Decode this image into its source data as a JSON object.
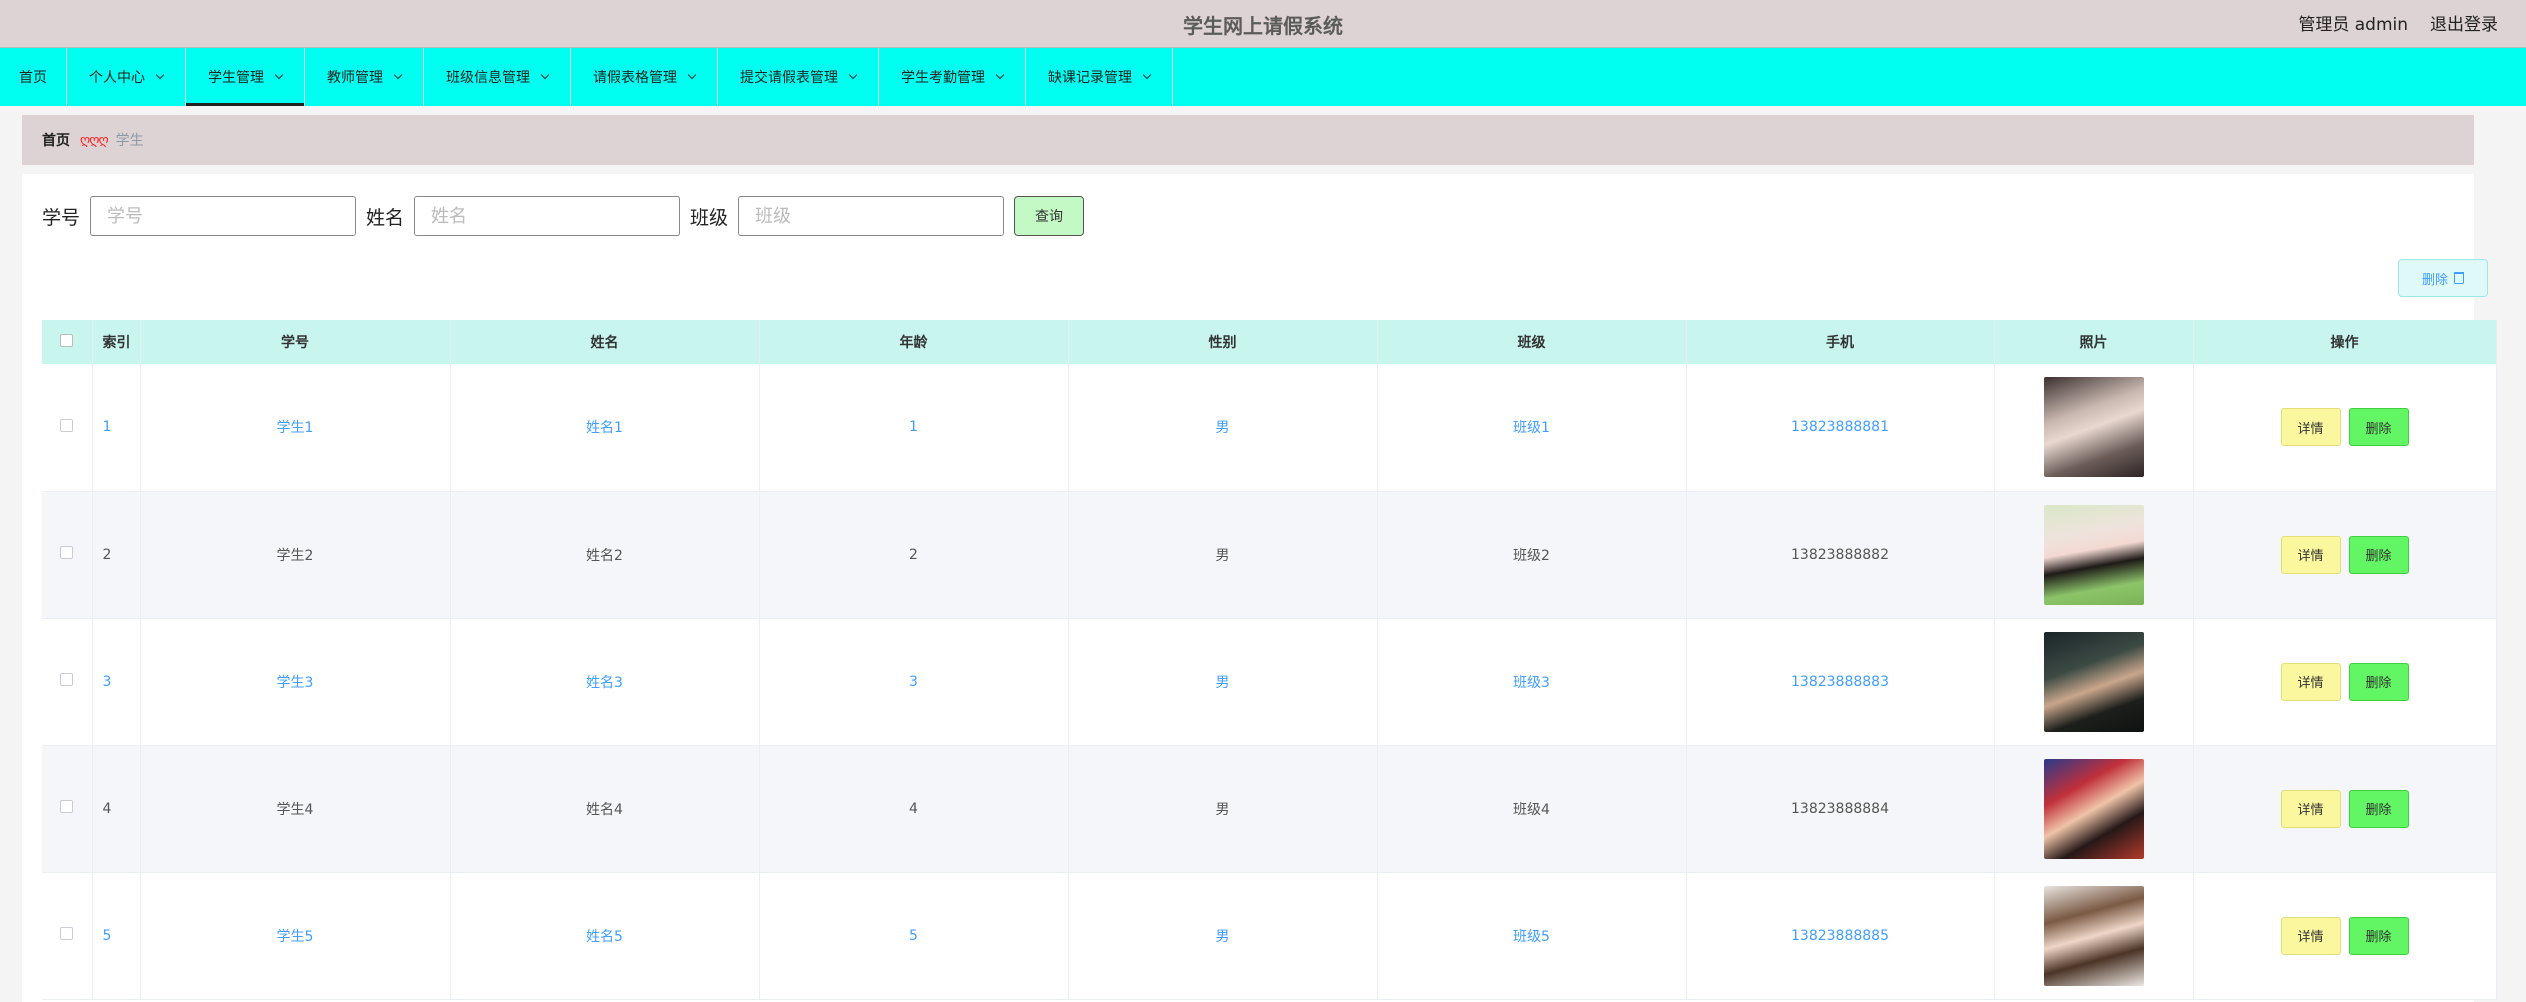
{
  "header": {
    "title": "学生网上请假系统",
    "user": "管理员 admin",
    "logout": "退出登录"
  },
  "nav": [
    {
      "label": "首页",
      "has_dropdown": false,
      "active": false
    },
    {
      "label": "个人中心",
      "has_dropdown": true,
      "active": false
    },
    {
      "label": "学生管理",
      "has_dropdown": true,
      "active": true
    },
    {
      "label": "教师管理",
      "has_dropdown": true,
      "active": false
    },
    {
      "label": "班级信息管理",
      "has_dropdown": true,
      "active": false
    },
    {
      "label": "请假表格管理",
      "has_dropdown": true,
      "active": false
    },
    {
      "label": "提交请假表管理",
      "has_dropdown": true,
      "active": false
    },
    {
      "label": "学生考勤管理",
      "has_dropdown": true,
      "active": false
    },
    {
      "label": "缺课记录管理",
      "has_dropdown": true,
      "active": false
    }
  ],
  "breadcrumb": {
    "home": "首页",
    "separator": "ღღღ",
    "current": "学生"
  },
  "search": {
    "fields": [
      {
        "label": "学号",
        "placeholder": "学号",
        "value": ""
      },
      {
        "label": "姓名",
        "placeholder": "姓名",
        "value": ""
      },
      {
        "label": "班级",
        "placeholder": "班级",
        "value": ""
      }
    ],
    "button": "查询"
  },
  "toolbar": {
    "bulk_delete": "删除"
  },
  "table": {
    "columns": [
      "索引",
      "学号",
      "姓名",
      "年龄",
      "性别",
      "班级",
      "手机",
      "照片",
      "操作"
    ],
    "rows": [
      {
        "index": "1",
        "student_id": "学生1",
        "name": "姓名1",
        "age": "1",
        "gender": "男",
        "class": "班级1",
        "phone": "13823888881",
        "photo": "photo-1"
      },
      {
        "index": "2",
        "student_id": "学生2",
        "name": "姓名2",
        "age": "2",
        "gender": "男",
        "class": "班级2",
        "phone": "13823888882",
        "photo": "photo-2"
      },
      {
        "index": "3",
        "student_id": "学生3",
        "name": "姓名3",
        "age": "3",
        "gender": "男",
        "class": "班级3",
        "phone": "13823888883",
        "photo": "photo-3"
      },
      {
        "index": "4",
        "student_id": "学生4",
        "name": "姓名4",
        "age": "4",
        "gender": "男",
        "class": "班级4",
        "phone": "13823888884",
        "photo": "photo-4"
      },
      {
        "index": "5",
        "student_id": "学生5",
        "name": "姓名5",
        "age": "5",
        "gender": "男",
        "class": "班级5",
        "phone": "13823888885",
        "photo": "photo-5"
      }
    ],
    "actions": {
      "detail": "详情",
      "delete": "删除"
    }
  },
  "colors": {
    "topbar": "#ddd3d4",
    "nav": "#00fff0",
    "table_header": "#c8f6ef",
    "link_text": "#409eff",
    "detail_button": "#fbf79e",
    "delete_button": "#62f564",
    "search_button": "#c3f9c5"
  }
}
